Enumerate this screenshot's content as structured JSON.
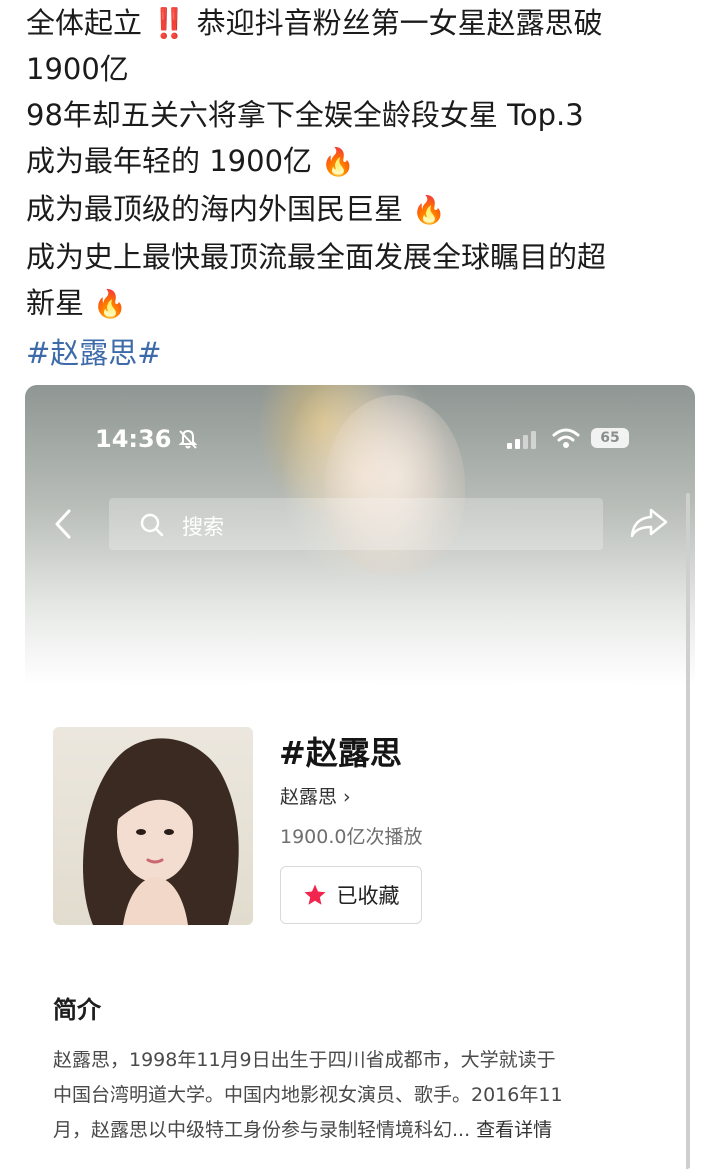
{
  "post": {
    "line1_text": "全体起立",
    "line1_bang": "‼️",
    "line1_rest": "恭迎抖音粉丝第一女星赵露思破",
    "line2": "1900亿",
    "line3": "98年却五关六将拿下全娱全龄段女星 Top.3",
    "line4": "成为最年轻的 1900亿",
    "line5": "成为最顶级的海内外国民巨星",
    "line6": "成为史上最快最顶流最全面发展全球瞩目的超",
    "line7": "新星",
    "fire_emoji": "🔥",
    "hashtag": "#赵露思#"
  },
  "screenshot": {
    "status_bar": {
      "time": "14:36",
      "battery": "65"
    },
    "search": {
      "placeholder": "搜索"
    },
    "topic": {
      "title": "#赵露思",
      "link": "赵露思 ›",
      "views": "1900.0亿次播放",
      "collect_label": "已收藏"
    },
    "intro": {
      "heading": "简介",
      "line1": "赵露思，1998年11月9日出生于四川省成都市，大学就读于",
      "line2": "中国台湾明道大学。中国内地影视女演员、歌手。2016年11",
      "line3": "月，赵露思以中级特工身份参与录制轻情境科幻...",
      "more": "查看详情"
    }
  },
  "colors": {
    "hashtag": "#3d6aa8",
    "collect_star": "#f0264f"
  },
  "icons": [
    "bell-off-icon",
    "signal-icon",
    "wifi-icon",
    "back-icon",
    "search-icon",
    "share-icon",
    "star-icon",
    "fire-emoji"
  ]
}
